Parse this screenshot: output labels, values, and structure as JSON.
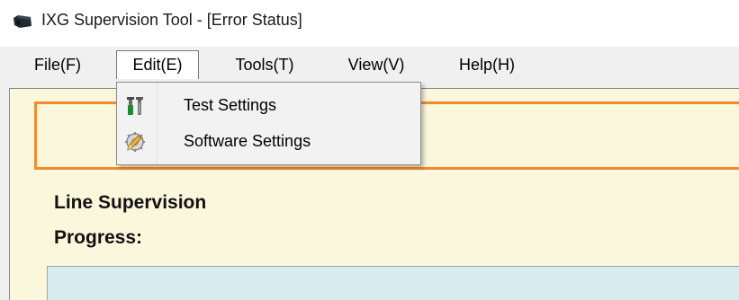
{
  "window": {
    "title": "IXG Supervision Tool - [Error Status]"
  },
  "menubar": {
    "items": [
      {
        "label": "File(F)"
      },
      {
        "label": "Edit(E)"
      },
      {
        "label": "Tools(T)"
      },
      {
        "label": "View(V)"
      },
      {
        "label": "Help(H)"
      }
    ]
  },
  "edit_menu": {
    "items": [
      {
        "label": "Test Settings",
        "icon": "tools-icon"
      },
      {
        "label": "Software Settings",
        "icon": "pencil-gear-icon"
      }
    ]
  },
  "main": {
    "line_supervision_label": "Line Supervision",
    "progress_label": "Progress:"
  },
  "colors": {
    "panel_bg": "#fbf7dc",
    "status_border": "#f28a2e",
    "progress_bg": "#d6ecef",
    "menubar_bg": "#f0f0f0"
  }
}
